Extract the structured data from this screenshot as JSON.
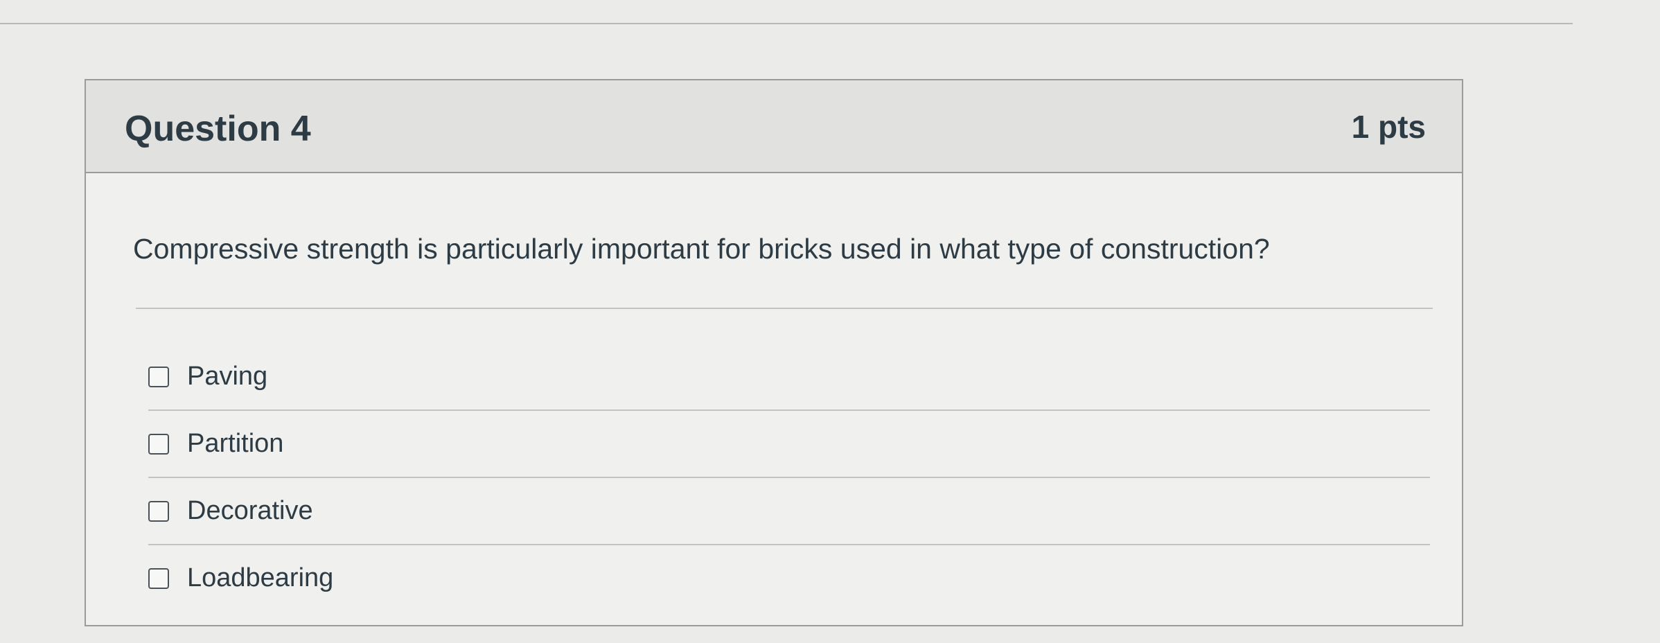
{
  "question": {
    "title": "Question 4",
    "points": "1 pts",
    "text": "Compressive strength is particularly important for bricks used in what type of construction?",
    "answers": [
      {
        "label": "Paving",
        "checked": false
      },
      {
        "label": "Partition",
        "checked": false
      },
      {
        "label": "Decorative",
        "checked": false
      },
      {
        "label": "Loadbearing",
        "checked": false
      }
    ]
  },
  "colors": {
    "page_bg": "#ebebe9",
    "card_bg": "#f0f0ee",
    "header_bg": "#e1e1df",
    "text": "#2d3b45",
    "border": "#9a9c9c"
  }
}
